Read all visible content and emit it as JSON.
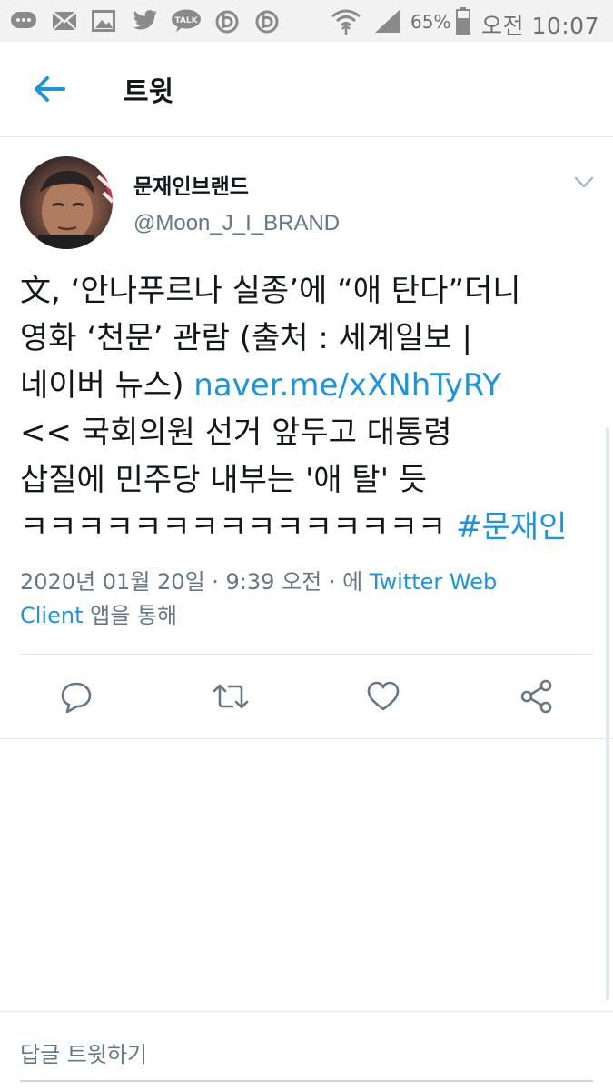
{
  "status_bar": {
    "notif_icons": [
      "chat-bubble-icon",
      "mail-icon",
      "gallery-icon",
      "twitter-icon",
      "kakaotalk-icon",
      "b-app-icon",
      "b-app-icon"
    ],
    "kakao_label": "TALK",
    "battery_percent": "65%",
    "time": "오전 10:07"
  },
  "header": {
    "title": "트윗",
    "back_icon": "arrow-left-icon"
  },
  "tweet": {
    "display_name": "문재인브랜드",
    "handle": "@Moon_J_I_BRAND",
    "body_lines": [
      {
        "text": "文, ‘안나푸르나 실종’에 “애 탄다”더니",
        "link": ""
      },
      {
        "text": "영화 ‘천문’ 관람 (출처 : 세계일보 |",
        "link": ""
      },
      {
        "text": "네이버 뉴스) ",
        "link": "naver.me/xXNhTyRY"
      },
      {
        "text": "<< 국회의원 선거 앞두고 대통령",
        "link": ""
      },
      {
        "text": "삽질에 민주당 내부는 '애 탈' 듯",
        "link": ""
      },
      {
        "text": "ㅋㅋㅋㅋㅋㅋㅋㅋㅋㅋㅋㅋㅋㅋㅋ ",
        "link": "#문재인"
      }
    ],
    "meta_prefix": "2020년 01월 20일 · 9:39 오전 · 에 ",
    "meta_source_line1": "Twitter Web",
    "meta_source_line2": "Client",
    "meta_suffix": " 앱을 통해"
  },
  "actions": {
    "reply_icon": "reply-icon",
    "retweet_icon": "retweet-icon",
    "like_icon": "heart-icon",
    "share_icon": "share-icon"
  },
  "reply_box": {
    "placeholder": "답글 트윗하기"
  },
  "colors": {
    "accent": "#1b95e0",
    "secondary_text": "#657786",
    "divider": "#e1e8ed"
  }
}
